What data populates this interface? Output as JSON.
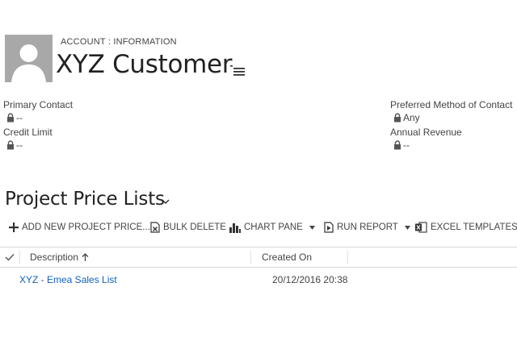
{
  "header": {
    "entity_type": "ACCOUNT : INFORMATION",
    "record_name": "XYZ Customer",
    "icons": {
      "avatar": "person-silhouette",
      "menu": "hamburger-menu-icon"
    }
  },
  "fields": {
    "primary_contact": {
      "label": "Primary Contact",
      "value": "--"
    },
    "credit_limit": {
      "label": "Credit Limit",
      "value": "--"
    },
    "preferred_method": {
      "label": "Preferred Method of Contact",
      "value": "Any"
    },
    "annual_revenue": {
      "label": "Annual Revenue",
      "value": "--"
    }
  },
  "subgrid": {
    "title": "Project Price Lists",
    "commands": {
      "add_new": "ADD NEW PROJECT PRICE...",
      "bulk_delete": "BULK DELETE",
      "chart_pane": "CHART PANE",
      "run_report": "RUN REPORT",
      "excel_templates": "EXCEL TEMPLATES"
    },
    "columns": {
      "description": "Description",
      "created_on": "Created On"
    },
    "rows": [
      {
        "description": "XYZ - Emea Sales List",
        "created_on": "20/12/2016 20:38"
      }
    ]
  },
  "colors": {
    "link": "#1160b7",
    "avatar_bg": "#a8a8a8",
    "text": "#444444"
  }
}
